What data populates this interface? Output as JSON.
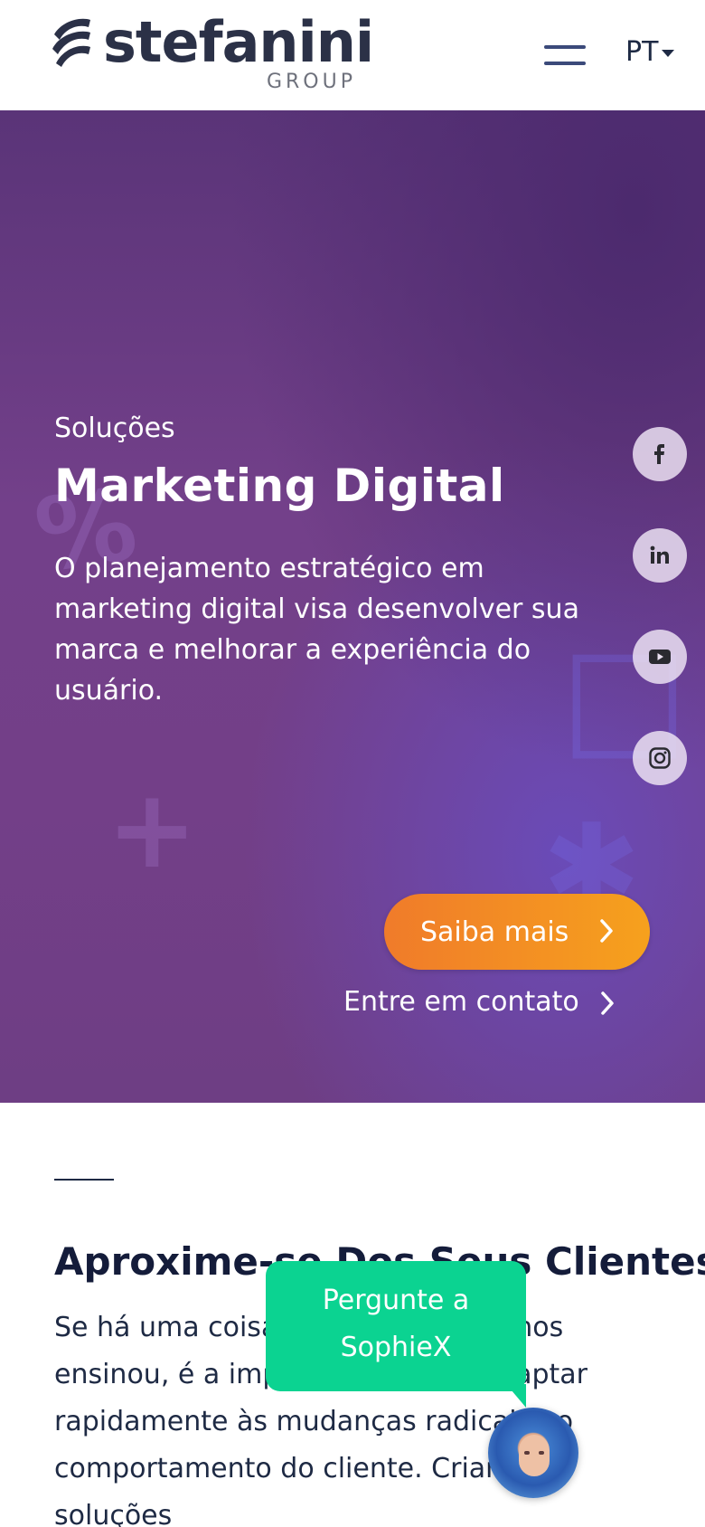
{
  "header": {
    "logo_word": "stefanini",
    "logo_sub": "GROUP",
    "language": "PT"
  },
  "hero": {
    "kicker": "Soluções",
    "title": "Marketing Digital",
    "description": "O planejamento estratégico em marketing digital visa desenvolver sua marca e melhorar a experiência do usuário.",
    "cta_primary": "Saiba mais",
    "cta_secondary": "Entre em contato"
  },
  "social": [
    {
      "name": "facebook-icon"
    },
    {
      "name": "linkedin-icon"
    },
    {
      "name": "youtube-icon"
    },
    {
      "name": "instagram-icon"
    }
  ],
  "section": {
    "title": "Aproxime-se Dos Seus Clientes",
    "body": "Se há uma coisa que a pandemia nos ensinou, é a importância de se adaptar rapidamente às mudanças radicais no comportamento do cliente. Criamos soluções"
  },
  "chat": {
    "prompt_line1": "Pergunte a",
    "prompt_line2": "SophieX"
  },
  "colors": {
    "hero_purple": "#73408a",
    "cta_orange": "#f07b2a",
    "chat_green": "#0bd391",
    "text_dark": "#141c3a"
  }
}
